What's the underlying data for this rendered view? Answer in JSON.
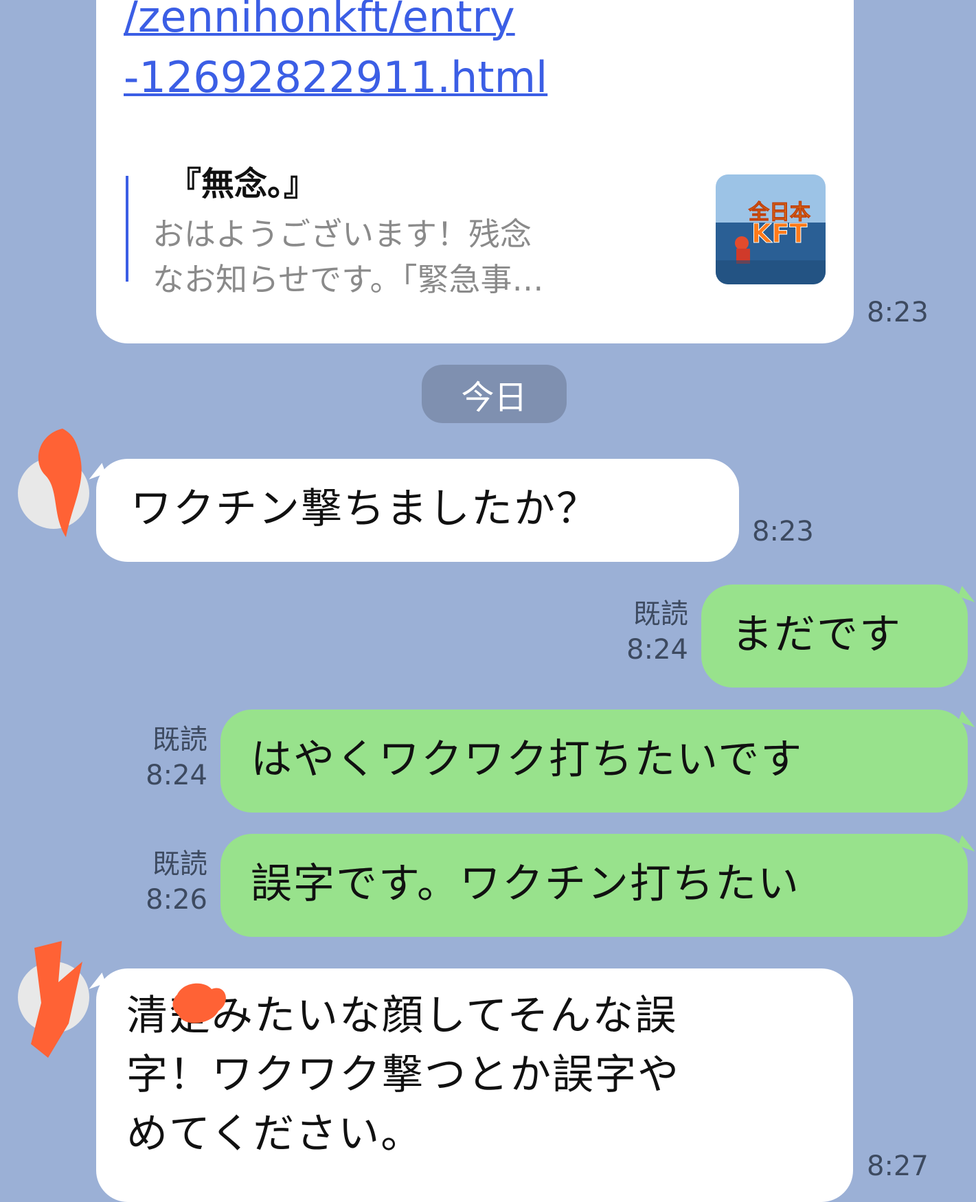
{
  "link_message": {
    "url_line1": "/zennihonkft/entry",
    "url_line2": "-12692822911.html",
    "preview_title": "『無念。』",
    "preview_desc_line1": "おはようございます！残念",
    "preview_desc_line2": "なお知らせです。「緊急事…",
    "thumb_label_line1": "全日本",
    "thumb_label_line2": "KFT",
    "time": "8:23"
  },
  "date_separator": "今日",
  "messages": [
    {
      "side": "left",
      "text": "ワクチン撃ちましたか？",
      "time": "8:23"
    },
    {
      "side": "right",
      "text": "まだです",
      "read": "既読",
      "time": "8:24"
    },
    {
      "side": "right",
      "text": "はやくワクワク打ちたいです",
      "read": "既読",
      "time": "8:24"
    },
    {
      "side": "right",
      "text": "誤字です。ワクチン打ちたい",
      "read": "既読",
      "time": "8:26"
    },
    {
      "side": "left",
      "lines": [
        "清楚みたいな顔してそんな誤",
        "字！ワクワク撃つとか誤字や",
        "めてください。"
      ],
      "time": "8:27"
    }
  ],
  "colors": {
    "background": "#9bb0d6",
    "my_bubble": "#98e28c",
    "their_bubble": "#ffffff",
    "link": "#3b5ee5"
  }
}
